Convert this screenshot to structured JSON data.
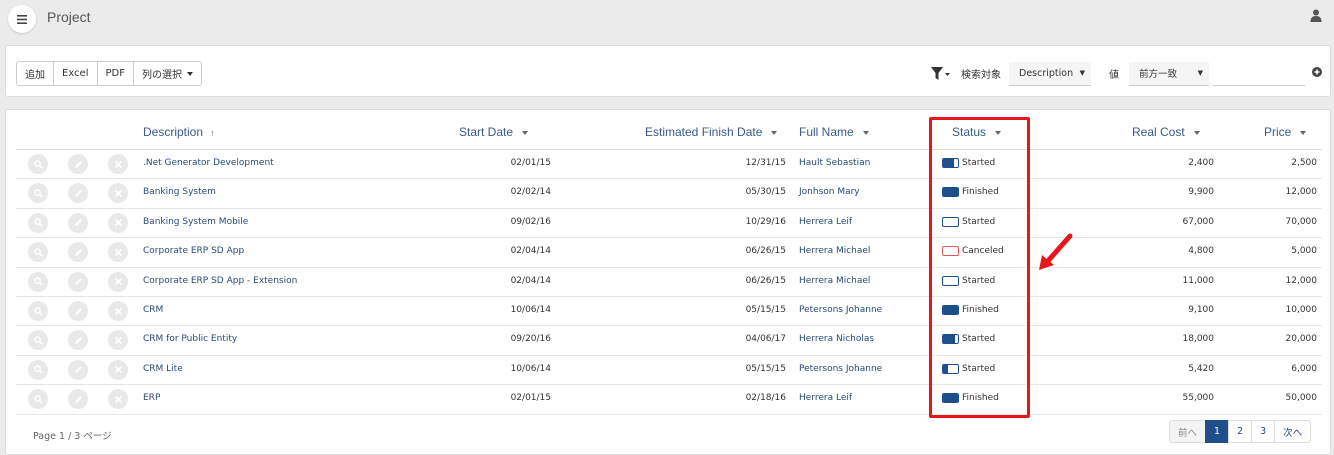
{
  "app": {
    "title": "Project"
  },
  "toolbar": {
    "add_label": "追加",
    "excel_label": "Excel",
    "pdf_label": "PDF",
    "columns_label": "列の選択",
    "search_target_label": "検索対象",
    "search_field_value": "Description",
    "value_label": "値",
    "match_mode_value": "前方一致",
    "search_value": ""
  },
  "columns": {
    "description": "Description",
    "start_date": "Start Date",
    "finish_date": "Estimated Finish Date",
    "full_name": "Full Name",
    "status": "Status",
    "real_cost": "Real Cost",
    "price": "Price"
  },
  "rows": [
    {
      "description": ".Net Generator Development",
      "start": "02/01/15",
      "finish": "12/31/15",
      "name": "Hault Sebastian",
      "status": "Started",
      "progress": 0.75,
      "real_cost": "2,400",
      "price": "2,500"
    },
    {
      "description": "Banking System",
      "start": "02/02/14",
      "finish": "05/30/15",
      "name": "Jonhson Mary",
      "status": "Finished",
      "progress": 1.0,
      "real_cost": "9,900",
      "price": "12,000"
    },
    {
      "description": "Banking System Mobile",
      "start": "09/02/16",
      "finish": "10/29/16",
      "name": "Herrera Leif",
      "status": "Started",
      "progress": 0.0,
      "real_cost": "67,000",
      "price": "70,000"
    },
    {
      "description": "Corporate ERP SD App",
      "start": "02/04/14",
      "finish": "06/26/15",
      "name": "Herrera Michael",
      "status": "Canceled",
      "progress": 0.0,
      "real_cost": "4,800",
      "price": "5,000"
    },
    {
      "description": "Corporate ERP SD App - Extension",
      "start": "02/04/14",
      "finish": "06/26/15",
      "name": "Herrera Michael",
      "status": "Started",
      "progress": 0.0,
      "real_cost": "11,000",
      "price": "12,000"
    },
    {
      "description": "CRM",
      "start": "10/06/14",
      "finish": "05/15/15",
      "name": "Petersons Johanne",
      "status": "Finished",
      "progress": 1.0,
      "real_cost": "9,100",
      "price": "10,000"
    },
    {
      "description": "CRM for Public Entity",
      "start": "09/20/16",
      "finish": "04/06/17",
      "name": "Herrera Nicholas",
      "status": "Started",
      "progress": 0.8,
      "real_cost": "18,000",
      "price": "20,000"
    },
    {
      "description": "CRM Lite",
      "start": "10/06/14",
      "finish": "05/15/15",
      "name": "Petersons Johanne",
      "status": "Started",
      "progress": 0.35,
      "real_cost": "5,420",
      "price": "6,000"
    },
    {
      "description": "ERP",
      "start": "02/01/15",
      "finish": "02/18/16",
      "name": "Herrera Leif",
      "status": "Finished",
      "progress": 1.0,
      "real_cost": "55,000",
      "price": "50,000"
    }
  ],
  "pager": {
    "page_text": "Page 1 / 3 ページ",
    "prev_label": "前へ",
    "pages": [
      "1",
      "2",
      "3"
    ],
    "next_label": "次へ",
    "current": "1"
  },
  "colors": {
    "accent": "#1f4f8a",
    "cancel": "#e45a5a",
    "highlight": "#e8161b"
  }
}
